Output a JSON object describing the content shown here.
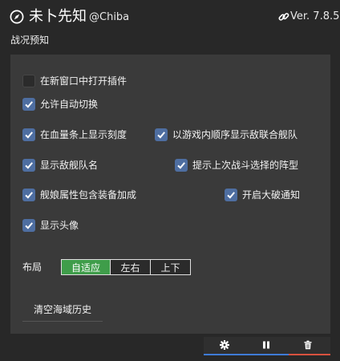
{
  "header": {
    "title": "未卜先知",
    "author": "@Chiba",
    "version": "Ver. 7.8.5"
  },
  "section_title": "战况预知",
  "options": {
    "new_window": {
      "label": "在新窗口中打开插件",
      "checked": false
    },
    "auto_switch": {
      "label": "允许自动切换",
      "checked": true
    },
    "hp_scale": {
      "label": "在血量条上显示刻度",
      "checked": true
    },
    "ingame_order": {
      "label": "以游戏内顺序显示敌联合舰队",
      "checked": true
    },
    "enemy_fleet_name": {
      "label": "显示敌舰队名",
      "checked": true
    },
    "last_formation": {
      "label": "提示上次战斗选择的阵型",
      "checked": true
    },
    "equip_bonus": {
      "label": "舰娘属性包含装备加成",
      "checked": true
    },
    "heavy_damage": {
      "label": "开启大破通知",
      "checked": true
    },
    "avatar": {
      "label": "显示头像",
      "checked": true
    }
  },
  "layout": {
    "label": "布局",
    "options": [
      "自适应",
      "左右",
      "上下"
    ],
    "selected": "自适应"
  },
  "clear_history": "清空海域历史",
  "toolbar": {
    "settings": "gear-icon",
    "pause": "pause-icon",
    "delete": "trash-icon",
    "colors": {
      "blue": "#3f7bd6",
      "red": "#d8513f"
    }
  }
}
